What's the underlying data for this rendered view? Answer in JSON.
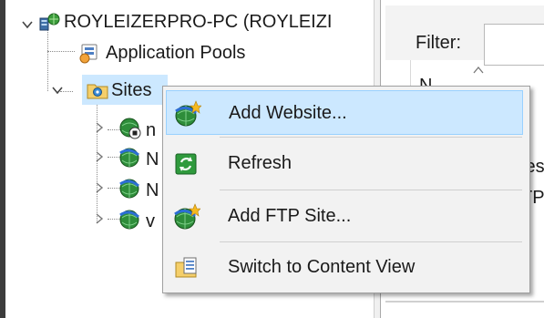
{
  "tree": {
    "server": {
      "label": "ROYLEIZERPRO-PC (ROYLEIZI",
      "icon": "server-icon"
    },
    "app_pools": {
      "label": "Application Pools",
      "icon": "application-pools-icon"
    },
    "sites": {
      "label": "Sites",
      "icon": "sites-folder-icon"
    },
    "site_items": [
      {
        "label": "n",
        "icon": "website-stopped-icon"
      },
      {
        "label": "N",
        "icon": "website-icon"
      },
      {
        "label": "N",
        "icon": "website-icon"
      },
      {
        "label": "v",
        "icon": "website-icon"
      }
    ]
  },
  "right_pane": {
    "filter_label": "Filter:",
    "column_header": "N",
    "fragment_1": "les",
    "fragment_2": "TP"
  },
  "context_menu": {
    "items": [
      {
        "label": "Add Website...",
        "icon": "add-website-globe-icon",
        "highlighted": true
      },
      {
        "label": "Refresh",
        "icon": "refresh-icon",
        "highlighted": false
      },
      {
        "label": "Add FTP Site...",
        "icon": "add-ftp-globe-icon",
        "highlighted": false
      },
      {
        "label": "Switch to Content View",
        "icon": "content-view-icon",
        "highlighted": false
      }
    ]
  },
  "colors": {
    "selection": "#cce8ff",
    "selection_border": "#99d1ff",
    "menu_bg": "#f2f2f2"
  }
}
